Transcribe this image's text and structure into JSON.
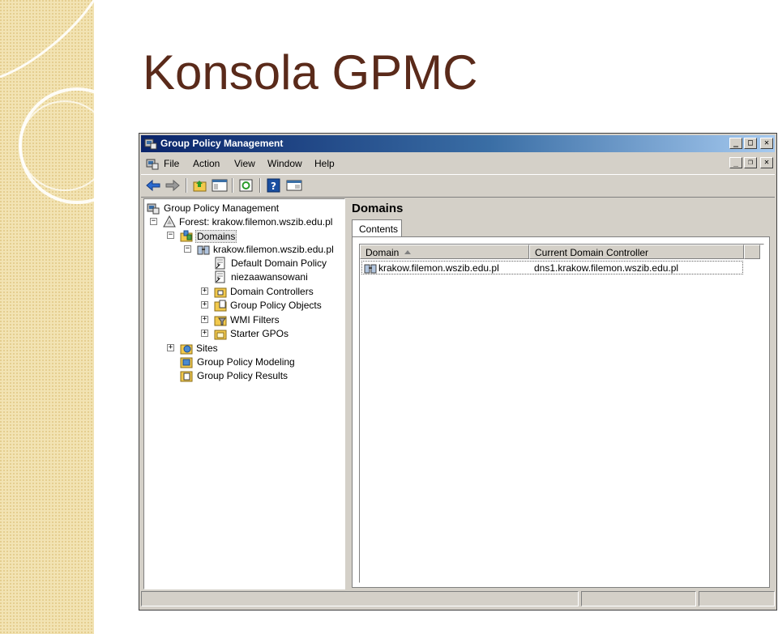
{
  "slide": {
    "title": "Konsola GPMC"
  },
  "window": {
    "title": "Group Policy Management",
    "caption_buttons": [
      "_",
      "□",
      "✕"
    ],
    "mdi_buttons": [
      "_",
      "❐",
      "✕"
    ]
  },
  "menu": {
    "items": [
      "File",
      "Action",
      "View",
      "Window",
      "Help"
    ]
  },
  "toolbar": {
    "buttons": [
      "back-icon",
      "forward-icon",
      "up-folder-icon",
      "show-hide-tree-icon",
      "refresh-icon",
      "help-icon",
      "properties-icon"
    ]
  },
  "tree": {
    "items": [
      {
        "label": "Group Policy Management",
        "icon": "gpm-console-icon",
        "expander": ""
      },
      {
        "label": "Forest: krakow.filemon.wszib.edu.pl",
        "icon": "forest-icon",
        "expander": "−"
      },
      {
        "label": "Domains",
        "icon": "domains-icon",
        "expander": "−"
      },
      {
        "label": "krakow.filemon.wszib.edu.pl",
        "icon": "domain-icon",
        "expander": "−"
      },
      {
        "label": "Default Domain Policy",
        "icon": "gpo-link-icon",
        "expander": ""
      },
      {
        "label": "niezaawansowani",
        "icon": "gpo-link-icon",
        "expander": ""
      },
      {
        "label": "Domain Controllers",
        "icon": "ou-folder-icon",
        "expander": "+"
      },
      {
        "label": "Group Policy Objects",
        "icon": "gpo-folder-icon",
        "expander": "+"
      },
      {
        "label": "WMI Filters",
        "icon": "wmi-folder-icon",
        "expander": "+"
      },
      {
        "label": "Starter GPOs",
        "icon": "starter-folder-icon",
        "expander": "+"
      },
      {
        "label": "Sites",
        "icon": "sites-icon",
        "expander": "+"
      },
      {
        "label": "Group Policy Modeling",
        "icon": "modeling-icon",
        "expander": ""
      },
      {
        "label": "Group Policy Results",
        "icon": "results-icon",
        "expander": ""
      }
    ]
  },
  "details": {
    "heading": "Domains",
    "tab": "Contents",
    "columns": [
      "Domain",
      "Current Domain Controller"
    ],
    "rows": [
      {
        "domain": "krakow.filemon.wszib.edu.pl",
        "controller": "dns1.krakow.filemon.wszib.edu.pl"
      }
    ]
  },
  "colors": {
    "title_text": "#5a2a1a",
    "titlebar_start": "#0a246a",
    "titlebar_end": "#a6caf0",
    "chrome": "#d4d0c8"
  }
}
